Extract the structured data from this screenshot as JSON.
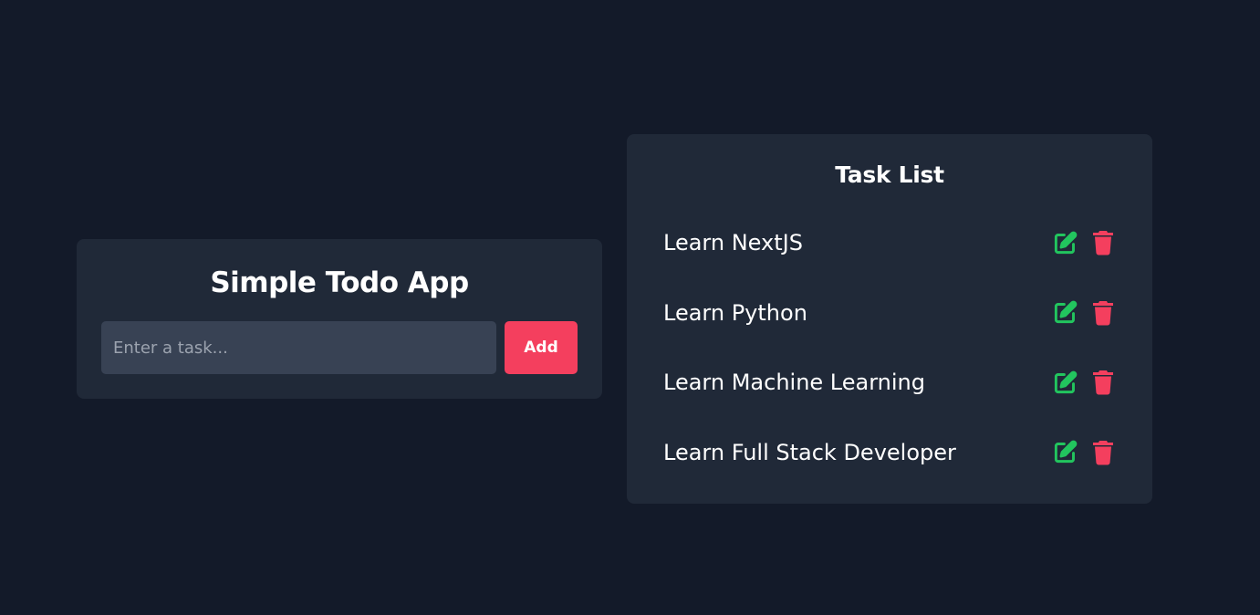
{
  "app": {
    "title": "Simple Todo App",
    "input": {
      "placeholder": "Enter a task...",
      "value": ""
    },
    "add_label": "Add"
  },
  "task_list": {
    "title": "Task List",
    "items": [
      {
        "label": "Learn NextJS"
      },
      {
        "label": "Learn Python"
      },
      {
        "label": "Learn Machine Learning"
      },
      {
        "label": "Learn Full Stack Developer"
      }
    ],
    "actions": {
      "edit_icon": "edit-icon",
      "delete_icon": "trash-icon"
    }
  },
  "colors": {
    "background": "#131a29",
    "card": "#202938",
    "input": "#384254",
    "accent": "#f43f5e",
    "edit": "#22c55e",
    "delete": "#f43f5e"
  }
}
